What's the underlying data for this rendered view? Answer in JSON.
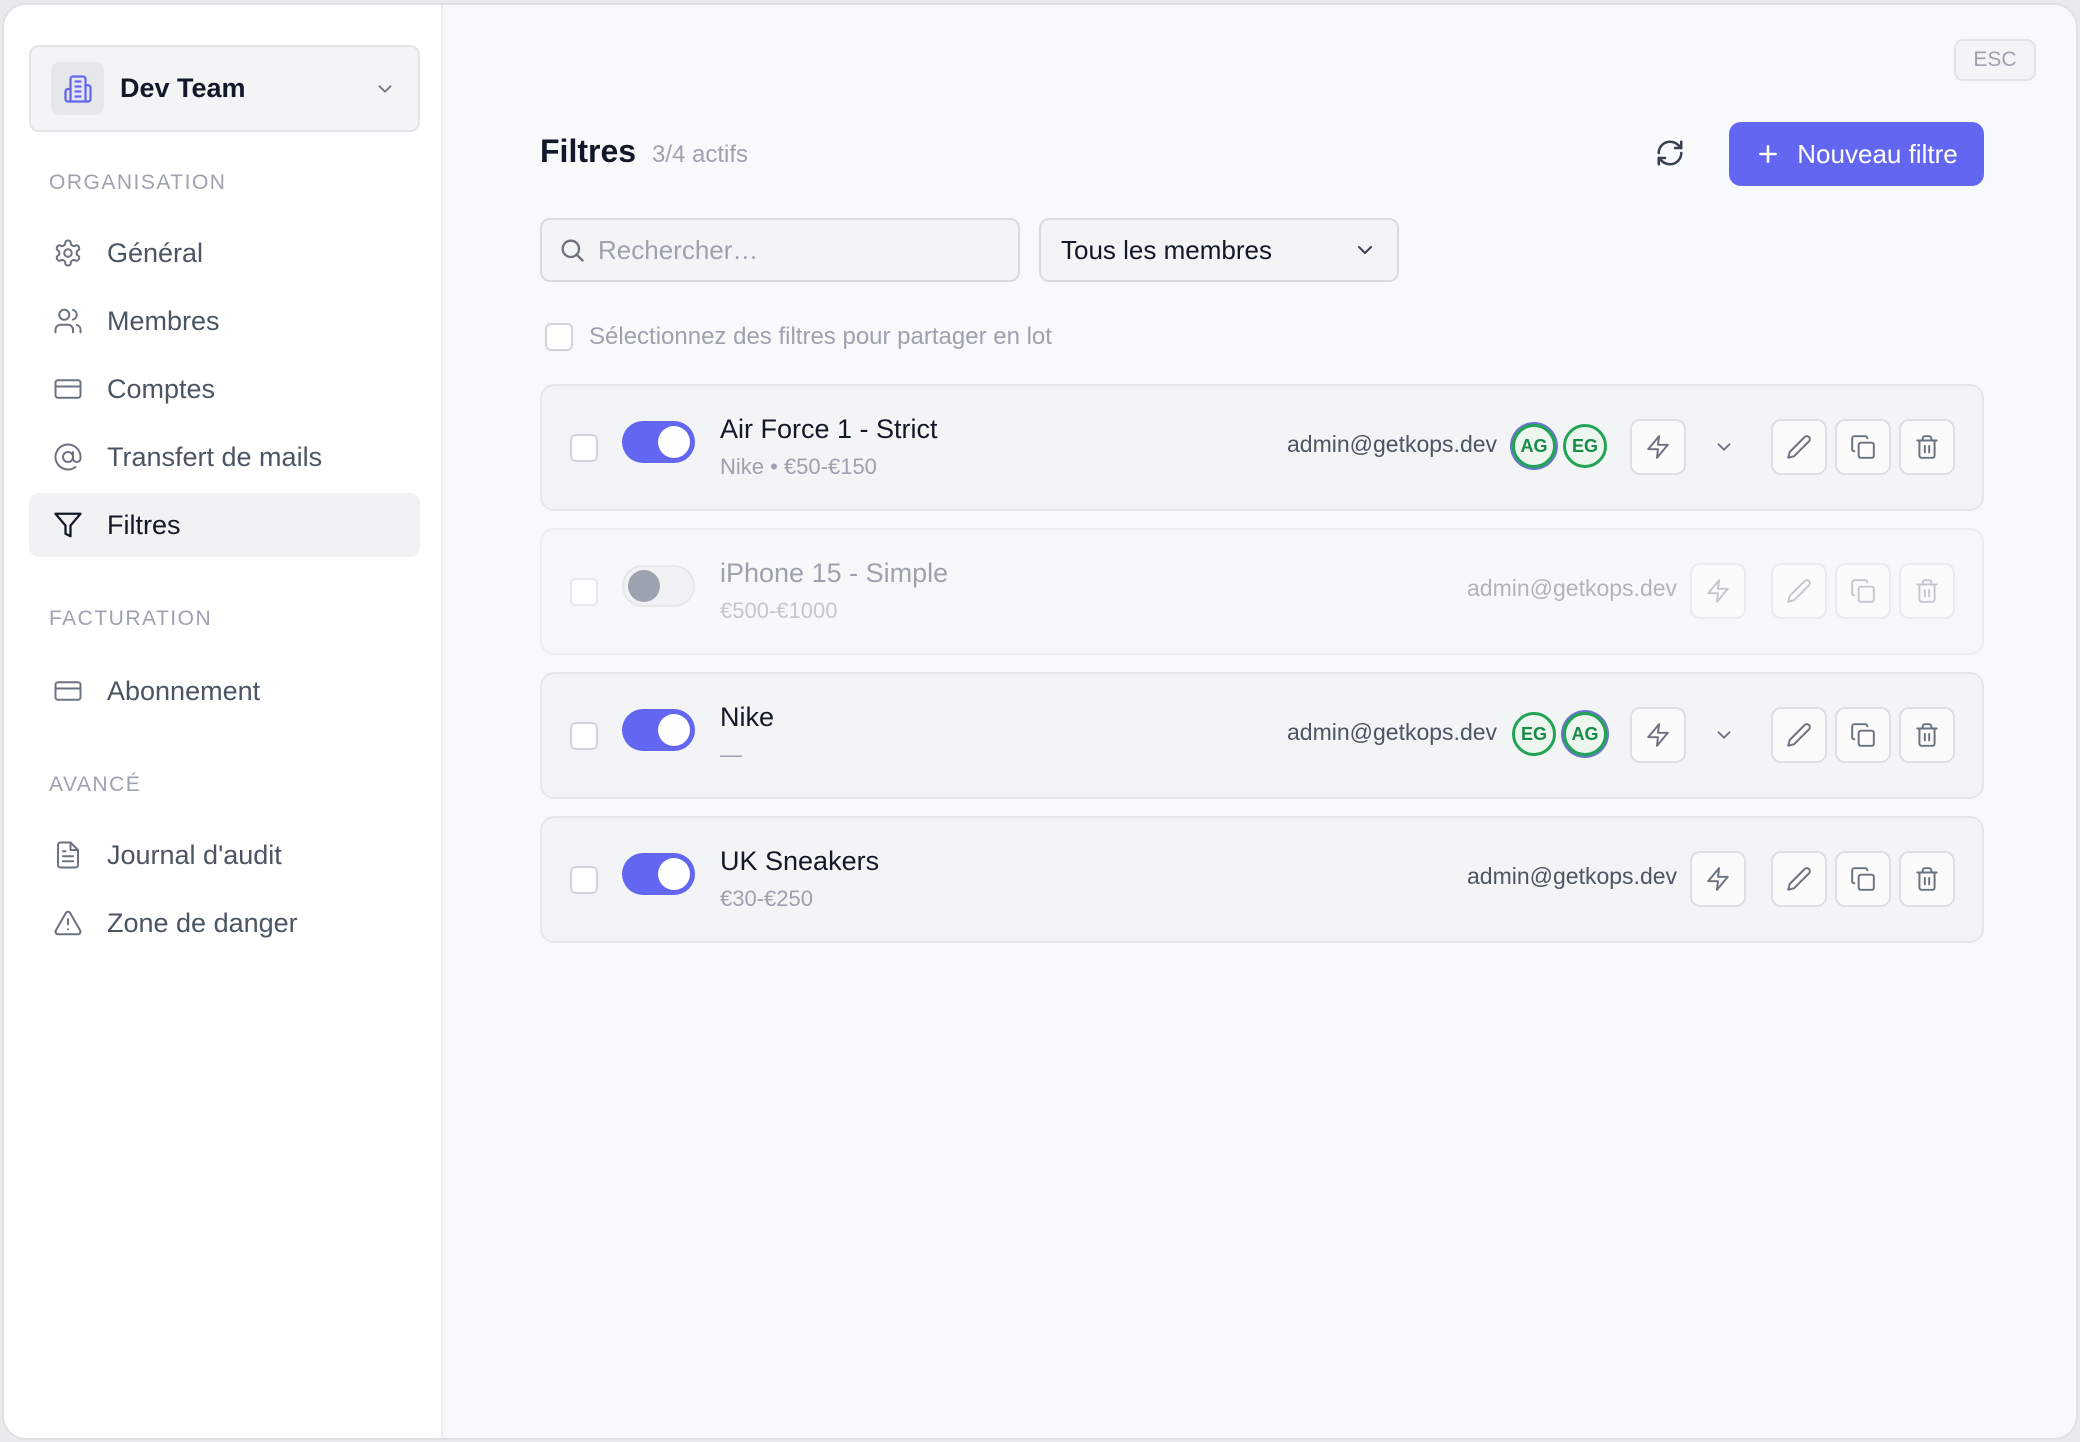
{
  "sidebar": {
    "team_name": "Dev Team",
    "sections": {
      "organisation": "ORGANISATION",
      "facturation": "FACTURATION",
      "avance": "AVANCÉ"
    },
    "items": {
      "general": "Général",
      "membres": "Membres",
      "comptes": "Comptes",
      "transfert": "Transfert de mails",
      "filtres": "Filtres",
      "abonnement": "Abonnement",
      "journal": "Journal d'audit",
      "danger": "Zone de danger"
    },
    "active_item": "Filtres"
  },
  "header": {
    "esc_label": "ESC",
    "title": "Filtres",
    "count": "3/4 actifs",
    "new_button": "Nouveau filtre"
  },
  "toolbar": {
    "search_placeholder": "Rechercher…",
    "member_filter": "Tous les membres",
    "bulk_label": "Sélectionnez des filtres pour partager en lot"
  },
  "filters": [
    {
      "name": "Air Force 1 - Strict",
      "subtitle": "Nike • €50-€150",
      "owner": "admin@getkops.dev",
      "enabled": true,
      "avatars": [
        "AG",
        "EG"
      ]
    },
    {
      "name": "iPhone 15 - Simple",
      "subtitle": "€500-€1000",
      "owner": "admin@getkops.dev",
      "enabled": false,
      "avatars": []
    },
    {
      "name": "Nike",
      "subtitle": "—",
      "owner": "admin@getkops.dev",
      "enabled": true,
      "avatars": [
        "EG",
        "AG"
      ]
    },
    {
      "name": "UK Sneakers",
      "subtitle": "€30-€250",
      "owner": "admin@getkops.dev",
      "enabled": true,
      "avatars": []
    }
  ],
  "colors": {
    "accent": "#6366f1",
    "avatar_ring": "#22a455",
    "avatar_text": "#178a47"
  }
}
